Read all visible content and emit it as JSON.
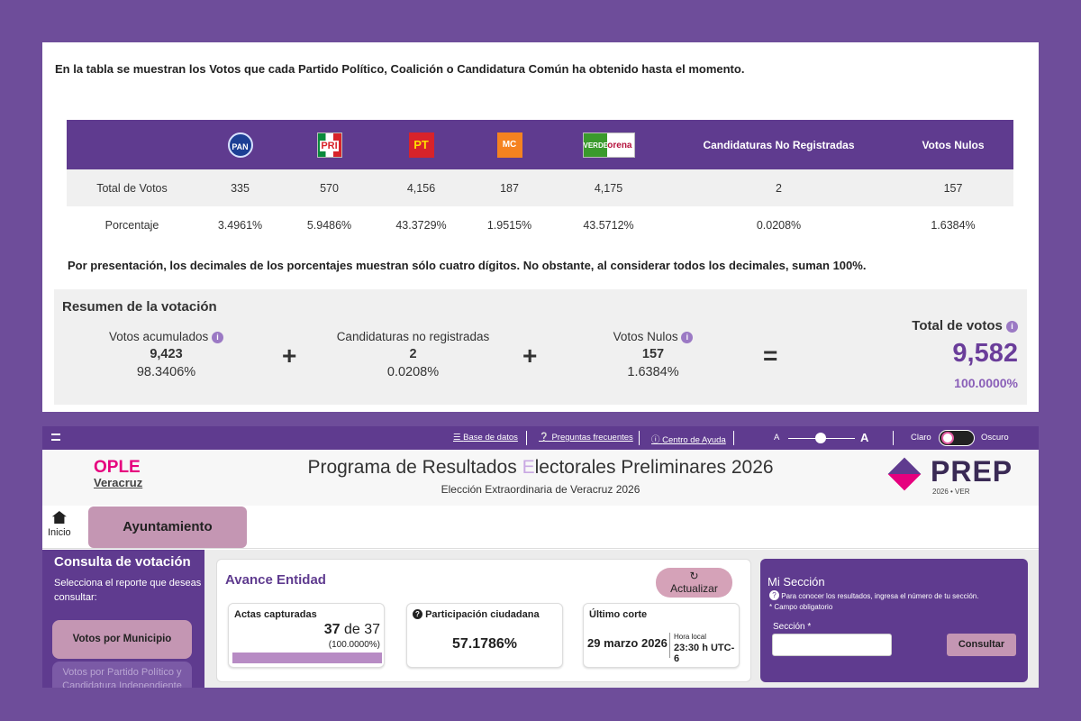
{
  "intro": "En la tabla se muestran los Votos que cada Partido Político, Coalición o Candidatura Común ha obtenido hasta el momento.",
  "table": {
    "parties": [
      {
        "name": "PAN",
        "icon": "pan-logo-icon",
        "color": "#1c3f94"
      },
      {
        "name": "PRI",
        "icon": "pri-logo-icon",
        "color": "#d8232a"
      },
      {
        "name": "PT",
        "icon": "pt-logo-icon",
        "color": "#d8232a"
      },
      {
        "name": "MC",
        "icon": "mc-logo-icon",
        "color": "#f58220"
      },
      {
        "name": "VERDE / morena",
        "icon": "verde-morena-logo-icon",
        "color": "#3a9a2c"
      }
    ],
    "col_no_registradas": "Candidaturas No Registradas",
    "col_nulos": "Votos Nulos",
    "rows": [
      {
        "label": "Total de Votos",
        "values": [
          "335",
          "570",
          "4,156",
          "187",
          "4,175",
          "2",
          "157"
        ]
      },
      {
        "label": "Porcentaje",
        "values": [
          "3.4961%",
          "5.9486%",
          "43.3729%",
          "1.9515%",
          "43.5712%",
          "0.0208%",
          "1.6384%"
        ]
      }
    ]
  },
  "note": "Por presentación, los decimales de los porcentajes muestran sólo cuatro dígitos. No obstante, al considerar todos los decimales, suman 100%.",
  "summary": {
    "title": "Resumen de la votación",
    "acumulados": {
      "label": "Votos acumulados",
      "value": "9,423",
      "pct": "98.3406%"
    },
    "no_registradas": {
      "label": "Candidaturas no registradas",
      "value": "2",
      "pct": "0.0208%"
    },
    "nulos": {
      "label": "Votos Nulos",
      "value": "157",
      "pct": "1.6384%"
    },
    "plus": "+",
    "equals": "=",
    "total": {
      "label": "Total de votos",
      "value": "9,582",
      "pct": "100.0000%"
    }
  },
  "topbar": {
    "base_datos": "Base de datos",
    "preguntas": "Preguntas frecuentes",
    "ayuda": "Centro de Ayuda",
    "font_small": "A",
    "font_large": "A",
    "claro": "Claro",
    "oscuro": "Oscuro"
  },
  "header": {
    "ople_top": "OPLE",
    "ople_bottom": "Veracruz",
    "title_a": "Programa de Resultados ",
    "title_e": "E",
    "title_b": "lectorales Preliminares 2026",
    "subtitle": "Elección Extraordinaria de Veracruz 2026",
    "prep": "PREP",
    "prep_sub": "2026 • VER"
  },
  "nav": {
    "home": "Inicio",
    "ayuntamiento": "Ayuntamiento"
  },
  "sidebar": {
    "title": "Consulta de votación",
    "desc": "Selecciona el reporte que deseas consultar:",
    "btn1": "Votos por Municipio",
    "btn2": "Votos por Partido Político y Candidatura Independiente"
  },
  "avance": {
    "title": "Avance Entidad",
    "refresh": "Actualizar",
    "actas_label": "Actas capturadas",
    "actas_count": "37",
    "actas_de": "de",
    "actas_total": "37",
    "actas_pct": "(100.0000%)",
    "actas_progress": 1.0,
    "part_label": "Participación ciudadana",
    "part_value": "57.1786%",
    "corte_label": "Último corte",
    "corte_date": "29 marzo 2026",
    "hora_label": "Hora local",
    "hora_value": "23:30 h UTC-6"
  },
  "seccion": {
    "title": "Mi Sección",
    "desc1": "Para conocer los resultados, ingresa el número de tu sección.",
    "desc2": "* Campo obligatorio",
    "label": "Sección *",
    "button": "Consultar"
  }
}
